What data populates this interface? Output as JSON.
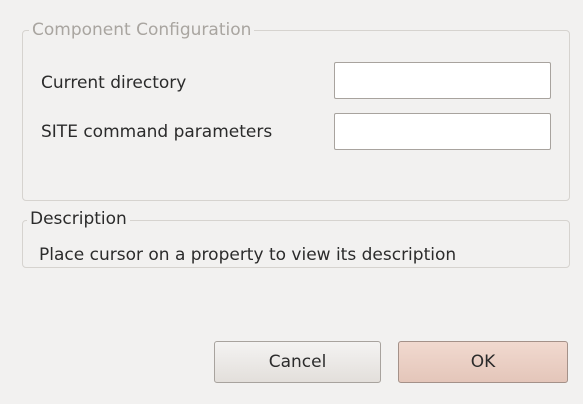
{
  "config_group": {
    "legend": "Component Configuration",
    "fields": [
      {
        "label": "Current directory",
        "value": ""
      },
      {
        "label": "SITE command parameters",
        "value": ""
      }
    ]
  },
  "description_group": {
    "legend": "Description",
    "text": "Place cursor on a property to view its description"
  },
  "buttons": {
    "cancel_label": "Cancel",
    "ok_label": "OK"
  }
}
